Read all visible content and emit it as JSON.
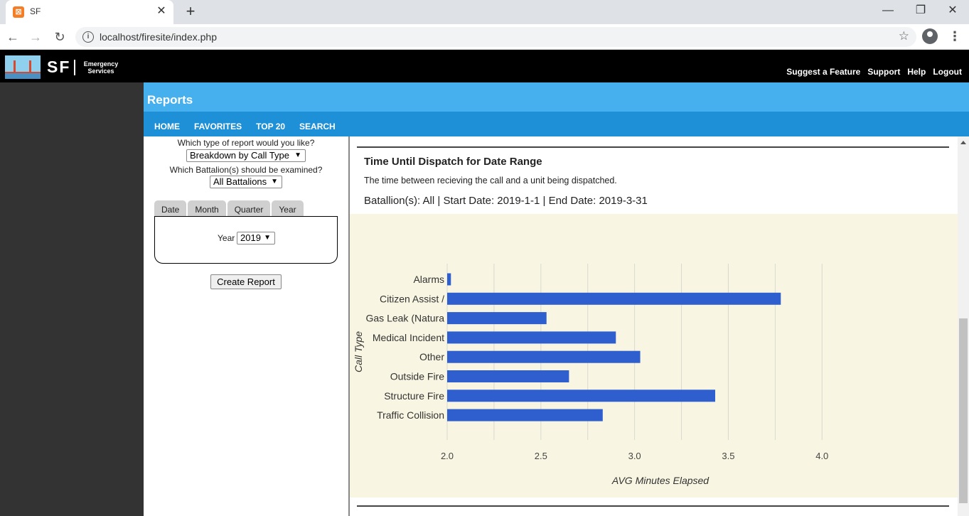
{
  "browser": {
    "tab_title": "SF",
    "tab_favicon": "xampp-icon",
    "url": "localhost/firesite/index.php"
  },
  "header": {
    "logo_text": "SF",
    "logo_sub1": "Emergency",
    "logo_sub2": "Services",
    "links": [
      "Suggest a Feature",
      "Support",
      "Help",
      "Logout"
    ]
  },
  "reports": {
    "title": "Reports",
    "nav": [
      "HOME",
      "FAVORITES",
      "TOP 20",
      "SEARCH"
    ]
  },
  "form": {
    "q_report_type": "Which type of report would you like?",
    "report_type_value": "Breakdown by Call Type",
    "q_battalion": "Which Battalion(s) should be examined?",
    "battalion_value": "All Battalions",
    "tabs": [
      "Date",
      "Month",
      "Quarter",
      "Year"
    ],
    "year_label": "Year",
    "year_value": "2019",
    "create_button": "Create Report"
  },
  "report": {
    "title": "Time Until Dispatch for Date Range",
    "description": "The time between recieving the call and a unit being dispatched.",
    "meta": "Batallion(s): All | Start Date: 2019-1-1 | End Date: 2019-3-31"
  },
  "colors": {
    "bar": "#2f5fcf",
    "chart_bg": "#f8f6e2",
    "reports_bar": "#46b0ef",
    "nav_bar": "#1e90d8"
  },
  "chart_data": {
    "type": "bar",
    "orientation": "horizontal",
    "categories": [
      "Alarms",
      "Citizen Assist /",
      "Gas Leak (Natura",
      "Medical Incident",
      "Other",
      "Outside Fire",
      "Structure Fire",
      "Traffic Collision"
    ],
    "values": [
      2.02,
      3.78,
      2.53,
      2.9,
      3.03,
      2.65,
      3.43,
      2.83
    ],
    "xlim": [
      2.0,
      4.2
    ],
    "xticks": [
      "2.0",
      "2.5",
      "3.0",
      "3.5",
      "4.0"
    ],
    "xtick_values": [
      2.0,
      2.5,
      3.0,
      3.5,
      4.0
    ],
    "xlabel": "AVG Minutes Elapsed",
    "ylabel": "Call Type",
    "grid": true
  }
}
